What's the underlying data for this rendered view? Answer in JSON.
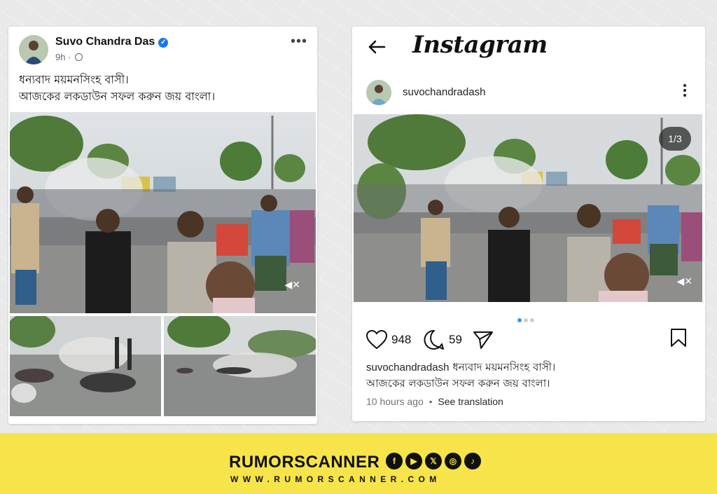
{
  "facebook_post": {
    "author": "Suvo Chandra Das",
    "time": "9h",
    "caption_line1": "ধন্যবাদ ময়মনসিংহ বাসী।",
    "caption_line2": "আজকের লকডাউন সফল করুন জয় বাংলা।",
    "icons": {
      "verified": "verified-badge-icon",
      "audience": "globe-icon",
      "more": "more-options-icon",
      "mute": "speaker-muted-icon"
    }
  },
  "instagram_post": {
    "app_title": "Instagram",
    "username": "suvochandradash",
    "image_counter": "1/3",
    "likes": "948",
    "comments": "59",
    "caption_user": "suvochandradash",
    "caption_line1": "ধন্যবাদ ময়মনসিংহ বাসী।",
    "caption_line2": "আজকের লকডাউন সফল করুন জয় বাংলা।",
    "time": "10 hours ago",
    "separator": "•",
    "see_translation": "See translation",
    "carousel": {
      "count": 3,
      "active": 1
    },
    "icons": {
      "back": "back-arrow-icon",
      "more": "vertical-dots-icon",
      "like": "heart-icon",
      "comment": "comment-bubble-icon",
      "share": "paper-plane-icon",
      "save": "bookmark-icon",
      "mute": "speaker-muted-icon"
    }
  },
  "footer": {
    "brand": "RUMORSCANNER",
    "website": "WWW.RUMORSCANNER.COM",
    "social_icons": [
      "facebook-icon",
      "youtube-icon",
      "x-icon",
      "instagram-icon",
      "tiktok-icon"
    ],
    "social_glyphs": [
      "f",
      "▶",
      "𝕏",
      "◎",
      "♪"
    ]
  },
  "colors": {
    "footer_bg": "#f6e44a",
    "verified": "#1877f2",
    "carousel_active": "#3897f0"
  }
}
